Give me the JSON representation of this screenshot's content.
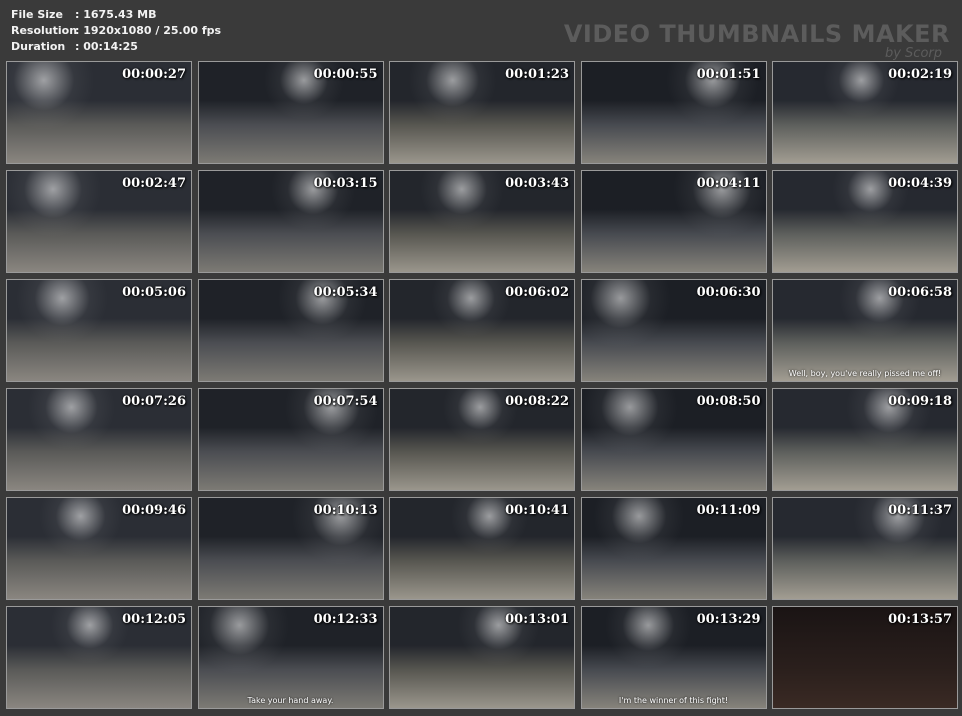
{
  "info": {
    "file_size_label": "File Size",
    "file_size_value": ": 1675.43 MB",
    "resolution_label": "Resolution",
    "resolution_value": ": 1920x1080 / 25.00 fps",
    "duration_label": "Duration",
    "duration_value": ": 00:14:25"
  },
  "watermark": {
    "title": "VIDEO THUMBNAILS MAKER",
    "subtitle": "by Scorp"
  },
  "thumbnails": [
    {
      "time": "00:00:27",
      "subtitle": ""
    },
    {
      "time": "00:00:55",
      "subtitle": ""
    },
    {
      "time": "00:01:23",
      "subtitle": ""
    },
    {
      "time": "00:01:51",
      "subtitle": ""
    },
    {
      "time": "00:02:19",
      "subtitle": ""
    },
    {
      "time": "00:02:47",
      "subtitle": ""
    },
    {
      "time": "00:03:15",
      "subtitle": ""
    },
    {
      "time": "00:03:43",
      "subtitle": ""
    },
    {
      "time": "00:04:11",
      "subtitle": ""
    },
    {
      "time": "00:04:39",
      "subtitle": ""
    },
    {
      "time": "00:05:06",
      "subtitle": ""
    },
    {
      "time": "00:05:34",
      "subtitle": ""
    },
    {
      "time": "00:06:02",
      "subtitle": ""
    },
    {
      "time": "00:06:30",
      "subtitle": ""
    },
    {
      "time": "00:06:58",
      "subtitle": "Well, boy, you've really pissed me off!"
    },
    {
      "time": "00:07:26",
      "subtitle": ""
    },
    {
      "time": "00:07:54",
      "subtitle": ""
    },
    {
      "time": "00:08:22",
      "subtitle": ""
    },
    {
      "time": "00:08:50",
      "subtitle": ""
    },
    {
      "time": "00:09:18",
      "subtitle": ""
    },
    {
      "time": "00:09:46",
      "subtitle": ""
    },
    {
      "time": "00:10:13",
      "subtitle": ""
    },
    {
      "time": "00:10:41",
      "subtitle": ""
    },
    {
      "time": "00:11:09",
      "subtitle": ""
    },
    {
      "time": "00:11:37",
      "subtitle": ""
    },
    {
      "time": "00:12:05",
      "subtitle": ""
    },
    {
      "time": "00:12:33",
      "subtitle": "Take your hand away."
    },
    {
      "time": "00:13:01",
      "subtitle": ""
    },
    {
      "time": "00:13:29",
      "subtitle": "I'm the winner of this fight!"
    },
    {
      "time": "00:13:57",
      "subtitle": ""
    }
  ]
}
